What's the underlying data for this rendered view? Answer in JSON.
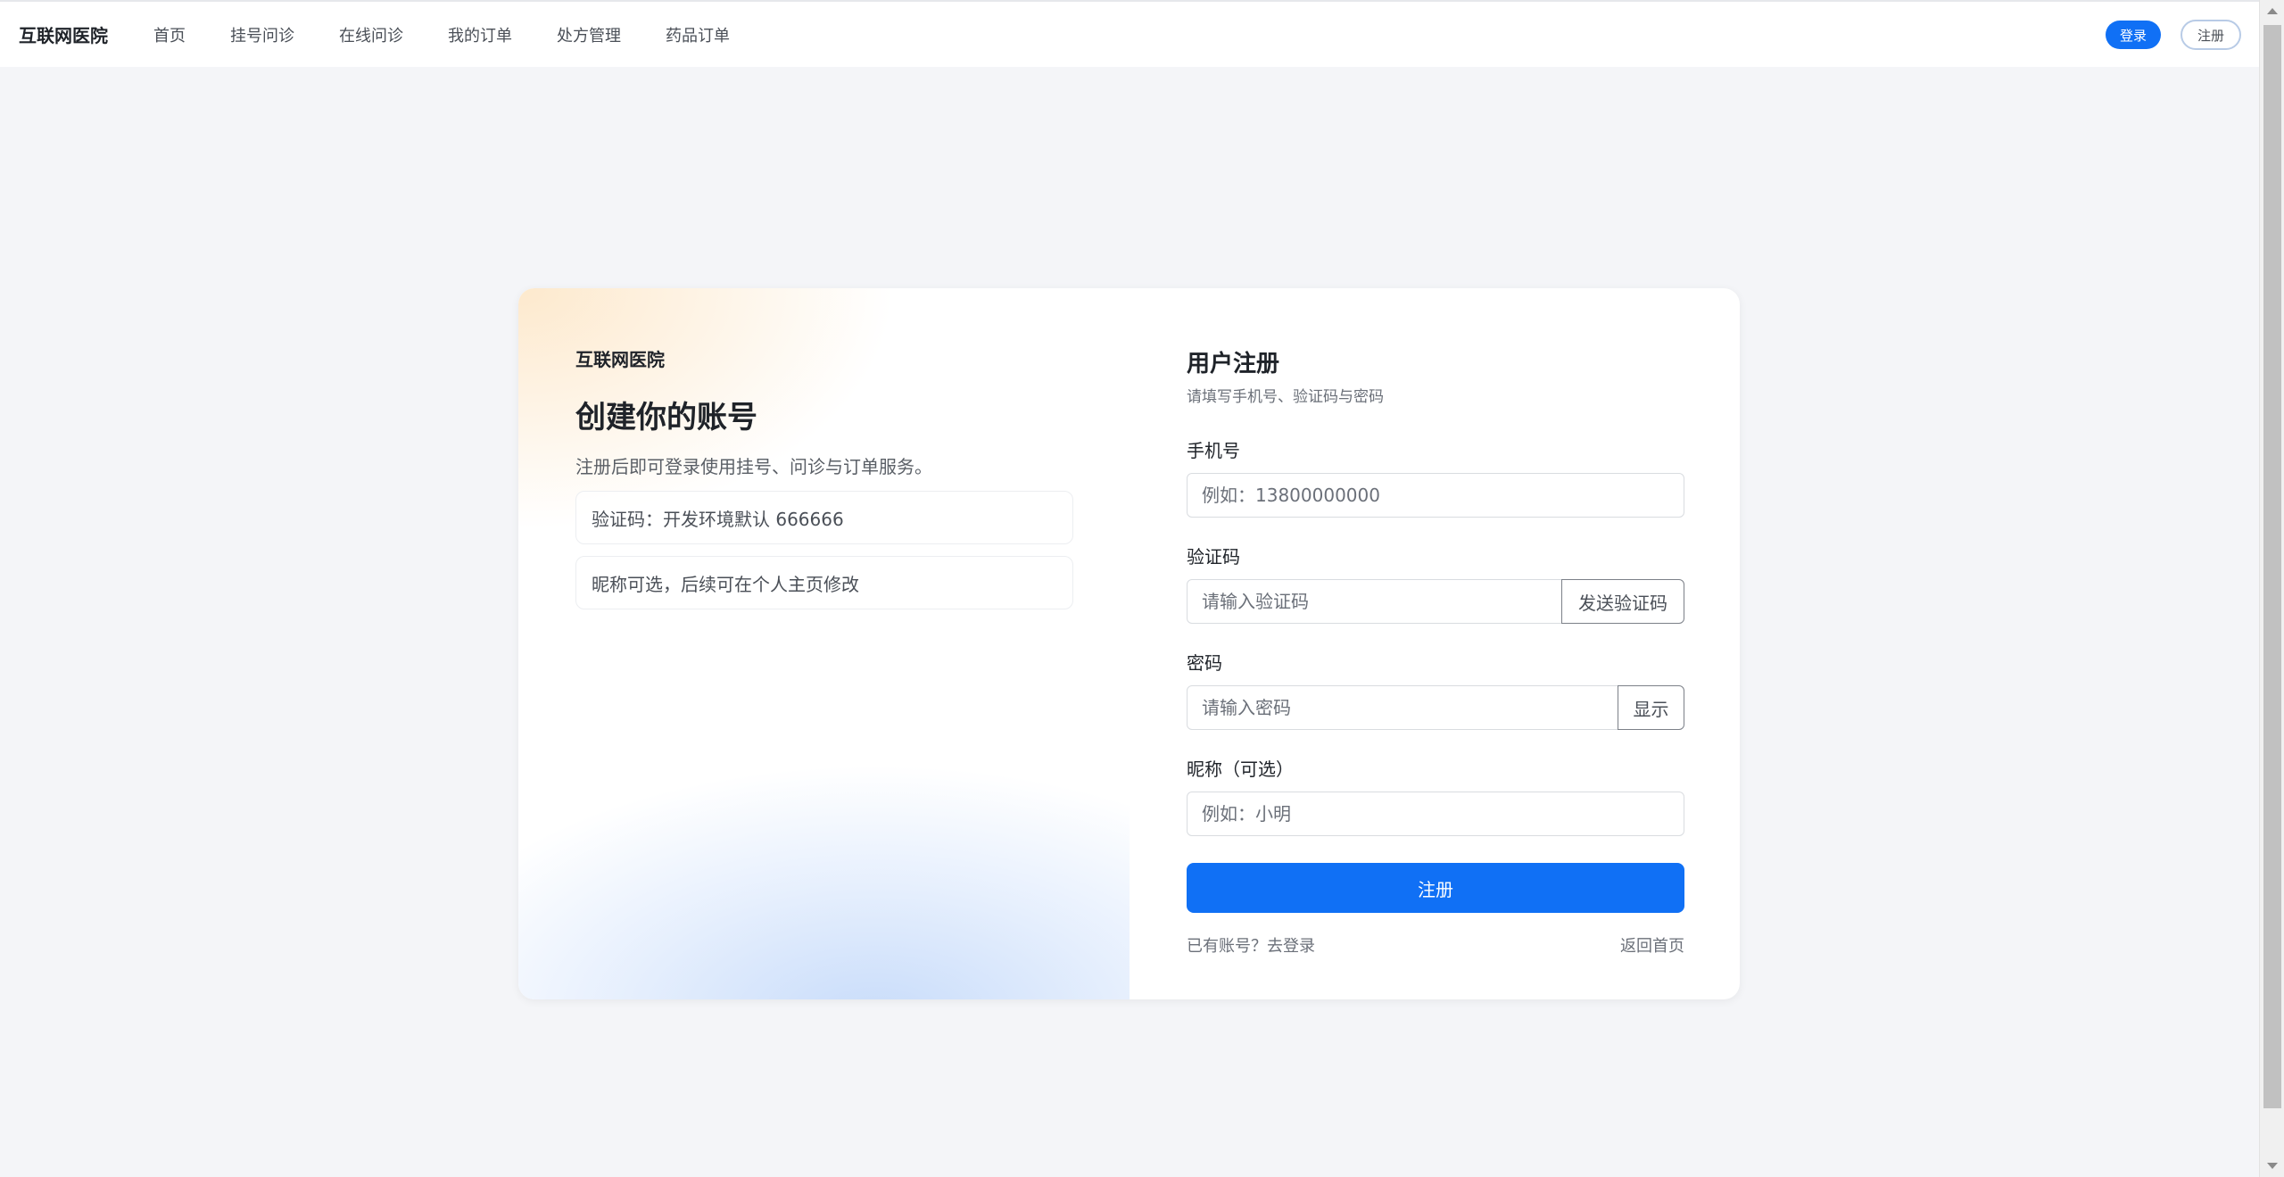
{
  "navbar": {
    "brand": "互联网医院",
    "links": [
      "首页",
      "挂号问诊",
      "在线问诊",
      "我的订单",
      "处方管理",
      "药品订单"
    ],
    "login_label": "登录",
    "register_label": "注册"
  },
  "intro": {
    "brand": "互联网医院",
    "title": "创建你的账号",
    "description": "注册后即可登录使用挂号、问诊与订单服务。",
    "notes": [
      "验证码：开发环境默认 666666",
      "昵称可选，后续可在个人主页修改"
    ]
  },
  "form": {
    "title": "用户注册",
    "subtitle": "请填写手机号、验证码与密码",
    "phone": {
      "label": "手机号",
      "placeholder": "例如：13800000000",
      "value": ""
    },
    "code": {
      "label": "验证码",
      "placeholder": "请输入验证码",
      "value": "",
      "send_label": "发送验证码"
    },
    "password": {
      "label": "密码",
      "placeholder": "请输入密码",
      "value": "",
      "toggle_label": "显示"
    },
    "nickname": {
      "label": "昵称（可选）",
      "placeholder": "例如：小明",
      "value": ""
    },
    "submit_label": "注册",
    "login_link": "已有账号？去登录",
    "home_link": "返回首页"
  },
  "colors": {
    "primary": "#1070f5",
    "page_background": "#f4f5f8"
  }
}
